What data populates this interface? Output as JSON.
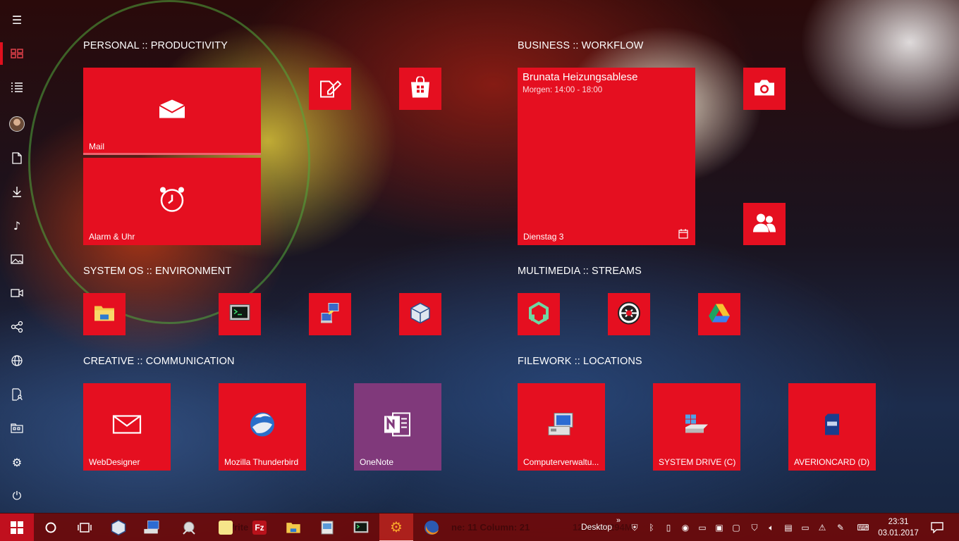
{
  "groups": {
    "personal": "PERSONAL :: PRODUCTIVITY",
    "business": "BUSINESS :: WORKFLOW",
    "system": "SYSTEM OS :: ENVIRONMENT",
    "multimedia": "MULTIMEDIA :: STREAMS",
    "creative": "CREATIVE :: COMMUNICATION",
    "filework": "FILEWORK :: LOCATIONS"
  },
  "tiles": {
    "mail": "Mail",
    "alarm": "Alarm & Uhr",
    "calendar": {
      "title": "Brunata Heizungsablese",
      "time": "Morgen: 14:00 - 18:00",
      "day": "Dienstag 3"
    },
    "webdesigner": "WebDesigner",
    "thunderbird": "Mozilla Thunderbird",
    "onenote": "OneNote",
    "computerverwaltung": "Computerverwaltu...",
    "system_drive": "SYSTEM DRIVE (C)",
    "averioncard": "AVERIONCARD (D)"
  },
  "rail": {
    "items": [
      "menu-icon",
      "tiles-icon",
      "all-apps-icon",
      "avatar",
      "documents-icon",
      "downloads-icon",
      "music-icon",
      "pictures-icon",
      "videos-icon",
      "network-icon",
      "personal-folder-icon",
      "file-explorer-icon",
      "settings-icon",
      "power-icon"
    ]
  },
  "taskbar": {
    "desktop_label": "Desktop",
    "chevrons": "»",
    "ghost_text_1": "Write",
    "ghost_text_2": "ne: 11 Column: 21",
    "ghost_text_3": "123M of 294M",
    "clock_time": "23:31",
    "clock_date": "03.01.2017"
  },
  "colors": {
    "tile_red": "#e50f20",
    "tile_purple": "#80397b",
    "taskbar": "#6e0a0a"
  }
}
